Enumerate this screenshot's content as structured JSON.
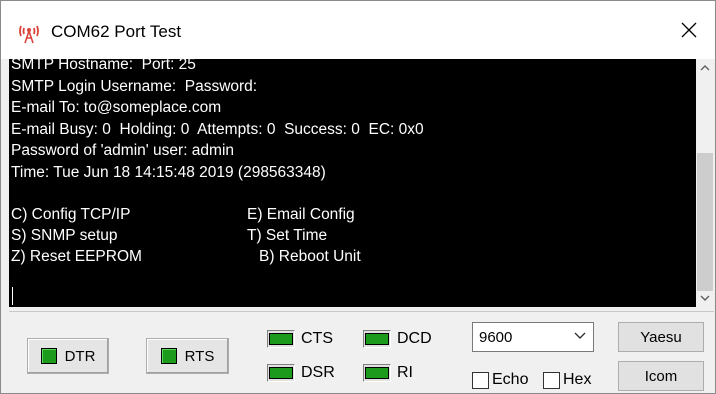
{
  "window": {
    "title": "COM62 Port Test"
  },
  "console": {
    "lines": [
      "SMTP Hostname:  Port: 25",
      "SMTP Login Username:  Password:",
      "E-mail To: to@someplace.com",
      "E-mail Busy: 0  Holding: 0  Attempts: 0  Success: 0  EC: 0x0",
      "Password of 'admin' user: admin",
      "Time: Tue Jun 18 14:15:48 2019 (298563348)",
      "",
      "C) Config TCP/IP",
      "S) SNMP setup",
      "Z) Reset EEPROM"
    ],
    "menu_right": [
      "E) Email Config",
      "T) Set Time",
      "B) Reboot Unit"
    ]
  },
  "controls": {
    "dtr_label": "DTR",
    "rts_label": "RTS",
    "cts_label": "CTS",
    "dcd_label": "DCD",
    "dsr_label": "DSR",
    "ri_label": "RI",
    "baud_value": "9600",
    "echo_label": "Echo",
    "hex_label": "Hex",
    "yaesu_label": "Yaesu",
    "icom_label": "Icom",
    "led_color": "#1c9a1c"
  }
}
